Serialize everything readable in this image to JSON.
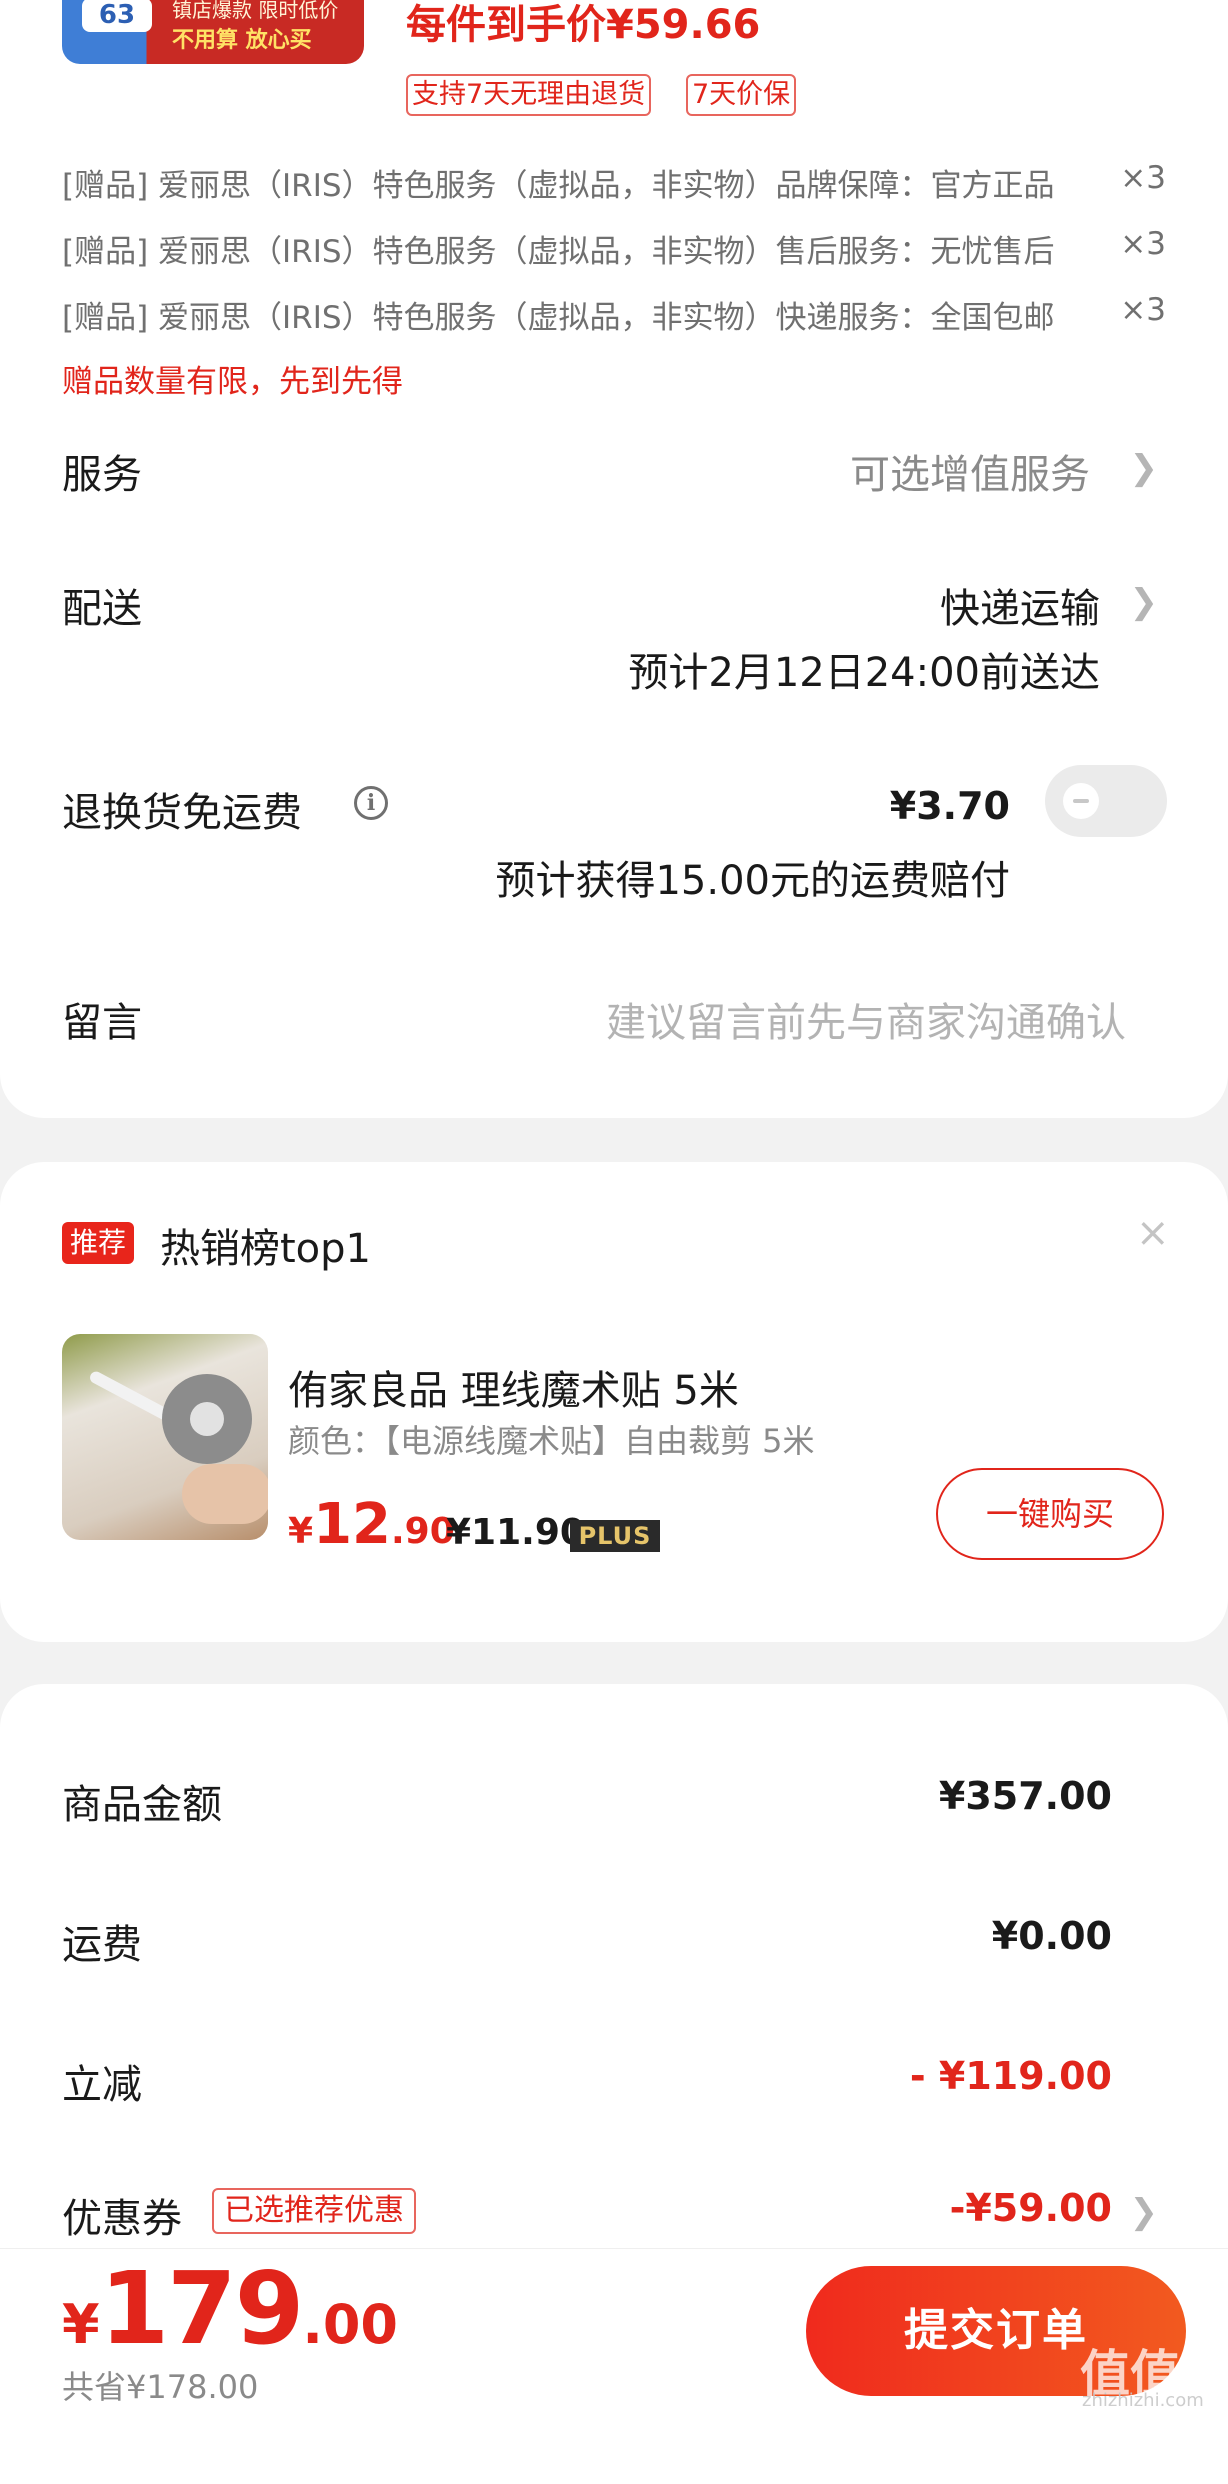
{
  "top_product": {
    "thumb_number": "63",
    "thumb_text_1": "镇店爆款 限时低价",
    "thumb_text_2": "不用算 放心买",
    "price_line": "每件到手价¥59.66",
    "tags": [
      "支持7天无理由退货",
      "7天价保"
    ]
  },
  "gifts": [
    {
      "text": "[赠品] 爱丽思（IRIS）特色服务（虚拟品，非实物）品牌保障：官方正品",
      "qty": "×3"
    },
    {
      "text": "[赠品] 爱丽思（IRIS）特色服务（虚拟品，非实物）售后服务：无忧售后",
      "qty": "×3"
    },
    {
      "text": "[赠品] 爱丽思（IRIS）特色服务（虚拟品，非实物）快递服务：全国包邮",
      "qty": "×3"
    }
  ],
  "gift_note": "赠品数量有限，先到先得",
  "service": {
    "label": "服务",
    "value": "可选增值服务"
  },
  "delivery": {
    "label": "配送",
    "value": "快递运输",
    "eta": "预计2月12日24:00前送达"
  },
  "return_shipping": {
    "label": "退换货免运费",
    "info_icon": "i",
    "price": "¥3.70",
    "note": "预计获得15.00元的运费赔付",
    "toggle_on": false
  },
  "message": {
    "label": "留言",
    "placeholder": "建议留言前先与商家沟通确认"
  },
  "recommend": {
    "badge": "推荐",
    "title": "热销榜top1",
    "close": "×",
    "product_name": "侑家良品 理线魔术贴 5米",
    "product_spec": "颜色：【电源线魔术贴】自由裁剪 5米",
    "price_yen": "¥",
    "price_int": "12",
    "price_dec": ".90",
    "plus_price": "¥11.90",
    "plus_badge": "PLUS",
    "buy_label": "一键购买"
  },
  "summary": {
    "goods_label": "商品金额",
    "goods_value": "¥357.00",
    "shipping_label": "运费",
    "shipping_value": "¥0.00",
    "discount_label": "立减",
    "discount_value": "- ¥119.00",
    "coupon_label": "优惠券",
    "coupon_tag": "已选推荐优惠",
    "coupon_value": "-¥59.00"
  },
  "bottom": {
    "total_yen": "¥",
    "total_int": "179",
    "total_dec": ".00",
    "saved": "共省¥178.00",
    "submit": "提交订单",
    "watermark": "值值值",
    "watermark_sub": "zhizhizhi.com"
  },
  "colors": {
    "accent": "#e1251b",
    "background": "#f2f2f2",
    "card": "#ffffff"
  }
}
